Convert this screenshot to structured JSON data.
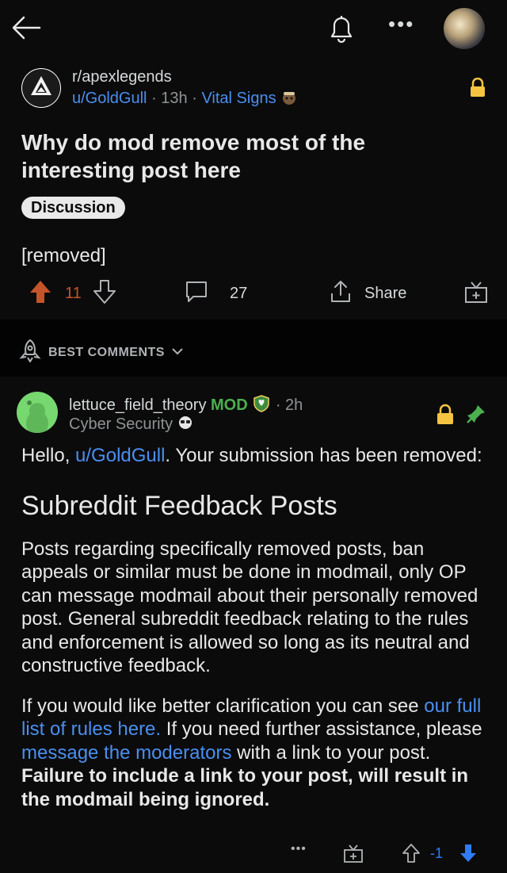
{
  "header": {
    "more_label": "•••"
  },
  "post": {
    "subreddit": "r/apexlegends",
    "author": "u/GoldGull",
    "age": "13h",
    "author_flair": "Vital Signs",
    "title": "Why do mod remove most of the interesting post here",
    "flair": "Discussion",
    "body": "[removed]",
    "score": "11",
    "comment_count": "27",
    "share_label": "Share"
  },
  "comments_header": {
    "label": "BEST COMMENTS"
  },
  "comment": {
    "username": "lettuce_field_theory",
    "mod_label": "MOD",
    "age": "2h",
    "flair": "Cyber Security",
    "greeting_prefix": "Hello, ",
    "greeting_user": "u/GoldGull",
    "greeting_suffix": ". Your submission has been removed:",
    "heading": "Subreddit Feedback Posts",
    "paragraph1": "Posts regarding specifically removed posts, ban appeals or similar must be done in modmail, only OP can message modmail about their personally removed post. General subreddit feedback relating to the rules and enforcement is allowed so long as its neutral and constructive feedback.",
    "p2_a": "If you would like better clarification you can see ",
    "p2_link1": "our full list of rules here.",
    "p2_b": " If you need further assistance, please ",
    "p2_link2": "message the moderators",
    "p2_c": " with a link to your post. ",
    "p2_bold": "Failure to include a link to your post, will result in the modmail being ignored.",
    "score": "-1",
    "more_label": "•••"
  },
  "colors": {
    "upvote": "#c4552b",
    "downvote": "#2f7cf6",
    "link": "#4a8ff0",
    "lock": "#f5c542",
    "mod": "#4caf50"
  }
}
